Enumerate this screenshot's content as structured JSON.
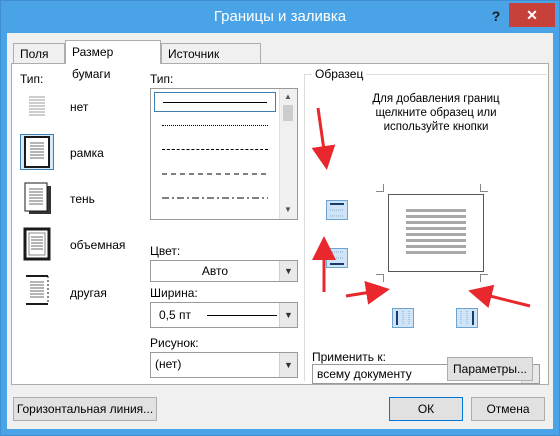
{
  "window": {
    "title": "Границы и заливка",
    "help_label": "?",
    "close_label": "✕"
  },
  "tabs": [
    {
      "label": "Поля",
      "active": false
    },
    {
      "label": "Размер бумаги",
      "active": true
    },
    {
      "label": "Источник бумаги",
      "active": false
    }
  ],
  "setting": {
    "label": "Тип:",
    "options": [
      {
        "label": "нет",
        "selected": false,
        "icon": "setting-none-icon"
      },
      {
        "label": "рамка",
        "selected": true,
        "icon": "setting-box-icon"
      },
      {
        "label": "тень",
        "selected": false,
        "icon": "setting-shadow-icon"
      },
      {
        "label": "объемная",
        "selected": false,
        "icon": "setting-3d-icon"
      },
      {
        "label": "другая",
        "selected": false,
        "icon": "setting-custom-icon"
      }
    ]
  },
  "style": {
    "label": "Тип:",
    "items": [
      "solid",
      "dotted",
      "dashed-small",
      "dashed",
      "dash-dot"
    ],
    "selected": "solid"
  },
  "color": {
    "label": "Цвет:",
    "value": "Авто"
  },
  "width": {
    "label": "Ширина:",
    "value": "0,5 пт"
  },
  "art": {
    "label": "Рисунок:",
    "value": "(нет)"
  },
  "preview": {
    "label": "Образец",
    "hint": "Для добавления границ щелкните образец или используйте кнопки"
  },
  "apply_to": {
    "label": "Применить к:",
    "value": "всему документу"
  },
  "buttons": {
    "options": "Параметры...",
    "horizontal_line": "Горизонтальная линия...",
    "ok": "ОК",
    "cancel": "Отмена"
  },
  "colors": {
    "titlebar": "#4aa3e6",
    "close": "#c7403a",
    "annotation_arrow": "#e8282c",
    "selection": "#3c7fb1"
  }
}
